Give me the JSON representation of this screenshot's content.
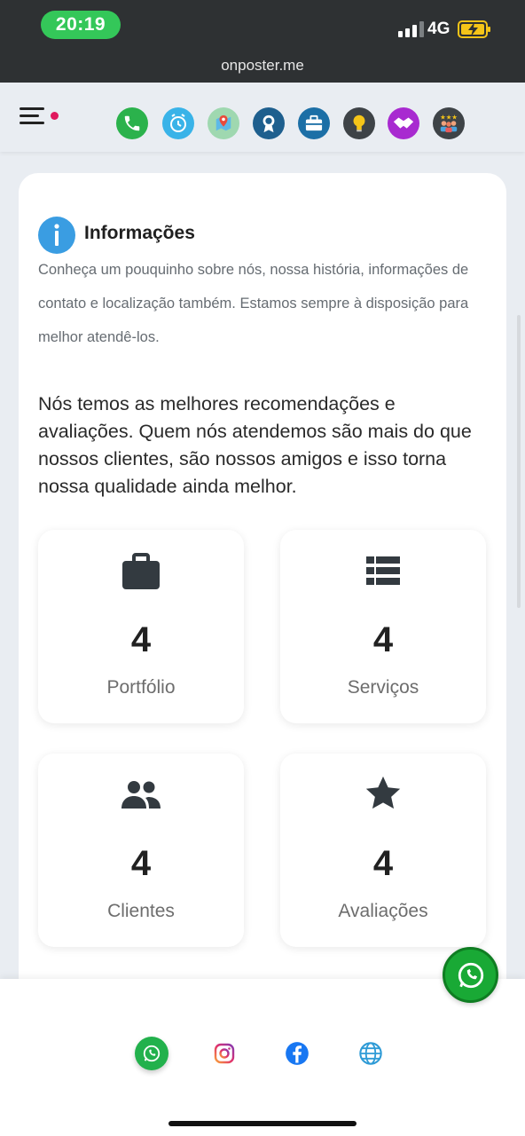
{
  "status_bar": {
    "time": "20:19",
    "network": "4G",
    "url": "onposter.me"
  },
  "nav": {
    "icons": [
      "phone-icon",
      "clock-icon",
      "map-pin-icon",
      "award-icon",
      "briefcase-icon",
      "lightbulb-icon",
      "handshake-icon",
      "reviews-icon"
    ],
    "colors": [
      "#2bb24c",
      "#39b3e8",
      "#9fd8b0",
      "#1e5f8e",
      "#1c6fa6",
      "#3e4347",
      "#a82ad0",
      "#3e4347"
    ]
  },
  "info": {
    "title": "Informações",
    "description": "Conheça um pouquinho sobre nós, nossa história, informações de contato e localização também. Estamos sempre à disposição para melhor atendê-los."
  },
  "lead": "Nós temos as melhores recomendações e avaliações. Quem nós atendemos são mais do que nossos clientes, são nossos amigos e isso torna nossa qualidade ainda melhor.",
  "stats": [
    {
      "icon": "briefcase-icon",
      "value": "4",
      "label": "Portfólio"
    },
    {
      "icon": "list-icon",
      "value": "4",
      "label": "Serviços"
    },
    {
      "icon": "users-icon",
      "value": "4",
      "label": "Clientes"
    },
    {
      "icon": "star-icon",
      "value": "4",
      "label": "Avaliações"
    }
  ],
  "bottom_bar": {
    "icons": [
      "whatsapp-icon",
      "instagram-icon",
      "facebook-icon",
      "globe-icon"
    ]
  },
  "colors": {
    "accent_info": "#3a9de2",
    "whatsapp": "#19a935"
  }
}
